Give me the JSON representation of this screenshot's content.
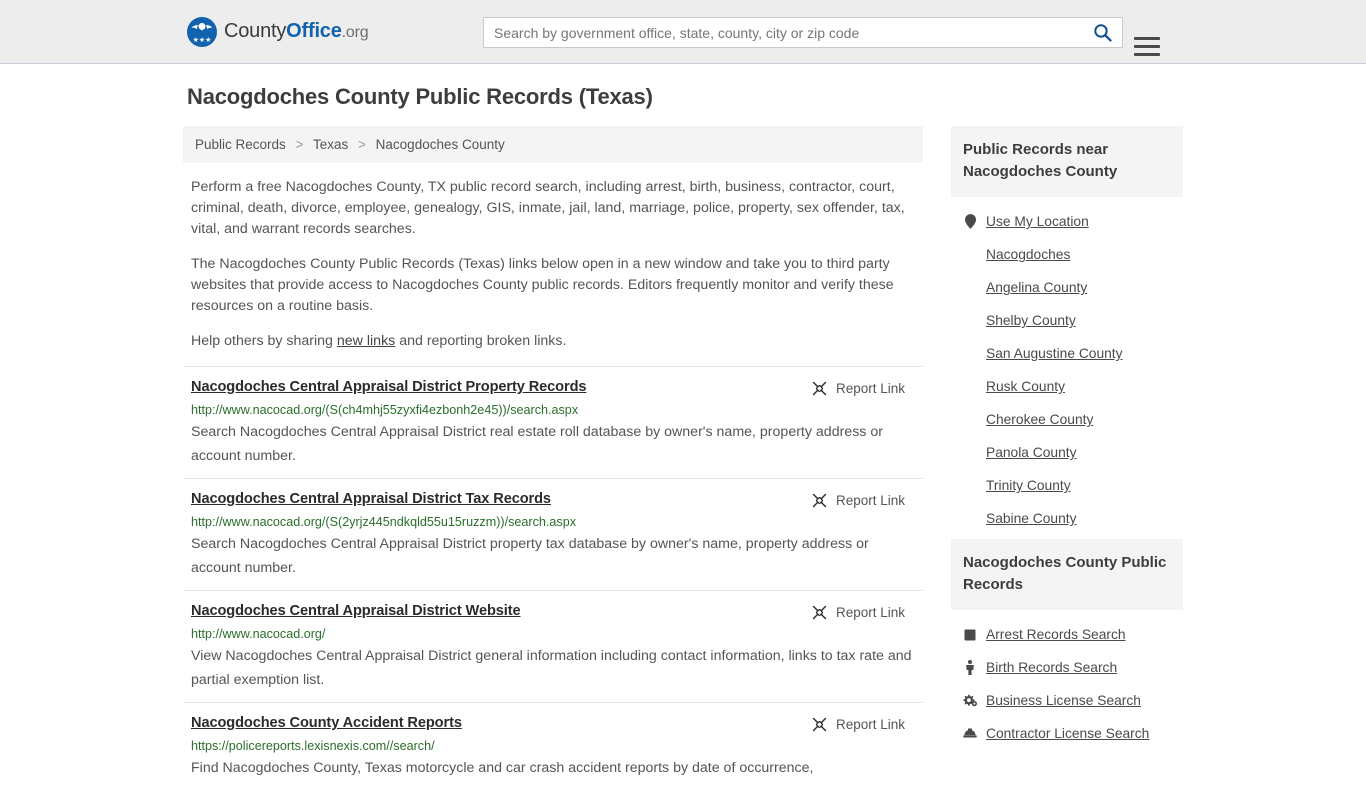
{
  "header": {
    "brand": {
      "part1": "County",
      "part2": "Office",
      "part3": ".org",
      "logo_icon": "eagle-shield-logo",
      "stars": "★★★"
    },
    "search": {
      "placeholder": "Search by government office, state, county, city or zip code",
      "value": "",
      "search_icon": "search-icon"
    },
    "menu_icon": "hamburger-menu-icon"
  },
  "page": {
    "title": "Nacogdoches County Public Records (Texas)"
  },
  "breadcrumb": {
    "items": [
      "Public Records",
      "Texas",
      "Nacogdoches County"
    ],
    "separator": ">"
  },
  "intro": {
    "paragraph1": "Perform a free Nacogdoches County, TX public record search, including arrest, birth, business, contractor, court, criminal, death, divorce, employee, genealogy, GIS, inmate, jail, land, marriage, police, property, sex offender, tax, vital, and warrant records searches.",
    "paragraph2": "The Nacogdoches County Public Records (Texas) links below open in a new window and take you to third party websites that provide access to Nacogdoches County public records. Editors frequently monitor and verify these resources on a routine basis.",
    "paragraph3_before": "Help others by sharing ",
    "paragraph3_link": "new links",
    "paragraph3_after": " and reporting broken links."
  },
  "report_link": {
    "label": "Report Link",
    "icon": "broken-link-icon"
  },
  "results": [
    {
      "title": "Nacogdoches Central Appraisal District Property Records",
      "url": "http://www.nacocad.org/(S(ch4mhj55zyxfi4ezbonh2e45))/search.aspx",
      "description": "Search Nacogdoches Central Appraisal District real estate roll database by owner's name, property address or account number."
    },
    {
      "title": "Nacogdoches Central Appraisal District Tax Records",
      "url": "http://www.nacocad.org/(S(2yrjz445ndkqld55u15ruzzm))/search.aspx",
      "description": "Search Nacogdoches Central Appraisal District property tax database by owner's name, property address or account number."
    },
    {
      "title": "Nacogdoches Central Appraisal District Website",
      "url": "http://www.nacocad.org/",
      "description": "View Nacogdoches Central Appraisal District general information including contact information, links to tax rate and partial exemption list."
    },
    {
      "title": "Nacogdoches County Accident Reports",
      "url": "https://policereports.lexisnexis.com//search/",
      "description": "Find Nacogdoches County, Texas motorcycle and car crash accident reports by date of occurrence,"
    }
  ],
  "sidebar": {
    "nearby": {
      "heading": "Public Records near Nacogdoches County",
      "items": [
        {
          "label": "Use My Location",
          "icon": "map-pin-icon"
        },
        {
          "label": "Nacogdoches",
          "icon": ""
        },
        {
          "label": "Angelina County",
          "icon": ""
        },
        {
          "label": "Shelby County",
          "icon": ""
        },
        {
          "label": "San Augustine County",
          "icon": ""
        },
        {
          "label": "Rusk County",
          "icon": ""
        },
        {
          "label": "Cherokee County",
          "icon": ""
        },
        {
          "label": "Panola County",
          "icon": ""
        },
        {
          "label": "Trinity County",
          "icon": ""
        },
        {
          "label": "Sabine County",
          "icon": ""
        }
      ]
    },
    "records": {
      "heading": "Nacogdoches County Public Records",
      "items": [
        {
          "label": "Arrest Records Search",
          "icon": "fingerprint-square-icon"
        },
        {
          "label": "Birth Records Search",
          "icon": "child-icon"
        },
        {
          "label": "Business License Search",
          "icon": "gears-icon"
        },
        {
          "label": "Contractor License Search",
          "icon": "hard-hat-icon"
        }
      ]
    }
  },
  "colors": {
    "brand_blue": "#1163ad",
    "header_bg": "#ededed",
    "url_green": "#2a6e2a",
    "panel_gray": "#f4f4f4"
  }
}
